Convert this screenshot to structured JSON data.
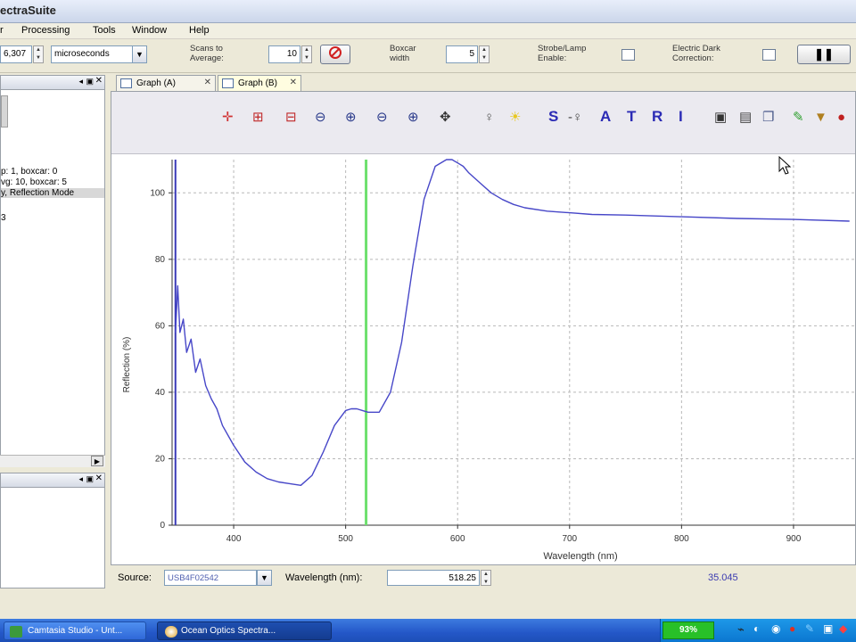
{
  "window": {
    "title": "ectraSuite"
  },
  "menu": [
    "r",
    "Processing",
    "Tools",
    "Window",
    "Help"
  ],
  "acquisition": {
    "integration_value": "6,307",
    "integration_unit": "microseconds",
    "scans_label": "Scans to Average:",
    "scans_value": "10",
    "boxcar_label": "Boxcar width",
    "boxcar_value": "5",
    "strobe_label": "Strobe/Lamp Enable:",
    "dark_label": "Electric Dark Correction:"
  },
  "left_panel": {
    "lines": [
      "p: 1, boxcar: 0",
      "vg: 10, boxcar: 5",
      "y, Reflection Mode",
      "3"
    ]
  },
  "tabs": [
    {
      "label": "Graph (A)",
      "active": false
    },
    {
      "label": "Graph (B)",
      "active": true
    }
  ],
  "graph_toolbar": {
    "icons": [
      "crosshair-icon",
      "zoom-box-icon",
      "zoom-vertical-icon",
      "zoom-out-icon",
      "zoom-in-icon",
      "zoom-out-x-icon",
      "zoom-fit-icon",
      "pan-icon",
      "bulb-off-icon",
      "bulb-on-icon"
    ],
    "mode_letters": [
      "S",
      "A",
      "T",
      "R",
      "I"
    ],
    "right_icons": [
      "save-icon",
      "print-icon",
      "copy-icon",
      "edit-icon",
      "export-icon",
      "stop-icon"
    ]
  },
  "source": {
    "label": "Source:",
    "value": "USB4F02542",
    "wavelength_label": "Wavelength (nm):",
    "wavelength_value": "518.25",
    "readout": "35.045"
  },
  "taskbar": {
    "items": [
      "Camtasia Studio - Unt...",
      "Ocean Optics Spectra..."
    ],
    "battery": "93%"
  },
  "chart_data": {
    "type": "line",
    "xlabel": "Wavelength (nm)",
    "ylabel": "Reflection (%)",
    "xlim": [
      345,
      955
    ],
    "ylim": [
      0,
      110
    ],
    "xticks": [
      400,
      500,
      600,
      700,
      800,
      900
    ],
    "yticks": [
      0,
      20,
      40,
      60,
      80,
      100
    ],
    "grid": true,
    "cursor_x": 518.25,
    "series": [
      {
        "color": "#4747c8",
        "x": [
          348,
          350,
          352,
          355,
          358,
          362,
          366,
          370,
          375,
          380,
          385,
          390,
          395,
          400,
          410,
          420,
          430,
          440,
          450,
          460,
          470,
          480,
          490,
          500,
          505,
          510,
          515,
          520,
          530,
          540,
          550,
          560,
          570,
          580,
          590,
          595,
          600,
          605,
          610,
          620,
          630,
          640,
          650,
          660,
          680,
          700,
          720,
          750,
          800,
          850,
          900,
          950
        ],
        "y": [
          58,
          72,
          58,
          62,
          52,
          56,
          46,
          50,
          42,
          38,
          35,
          30,
          27,
          24,
          19,
          16,
          14,
          13,
          12.5,
          12,
          15,
          22,
          30,
          34.5,
          35,
          35,
          34.5,
          34,
          34,
          40,
          55,
          78,
          98,
          108,
          110,
          110,
          109,
          108,
          106,
          103,
          100,
          98,
          96.5,
          95.5,
          94.5,
          94,
          93.5,
          93.3,
          92.8,
          92.3,
          92,
          91.5
        ]
      }
    ]
  }
}
